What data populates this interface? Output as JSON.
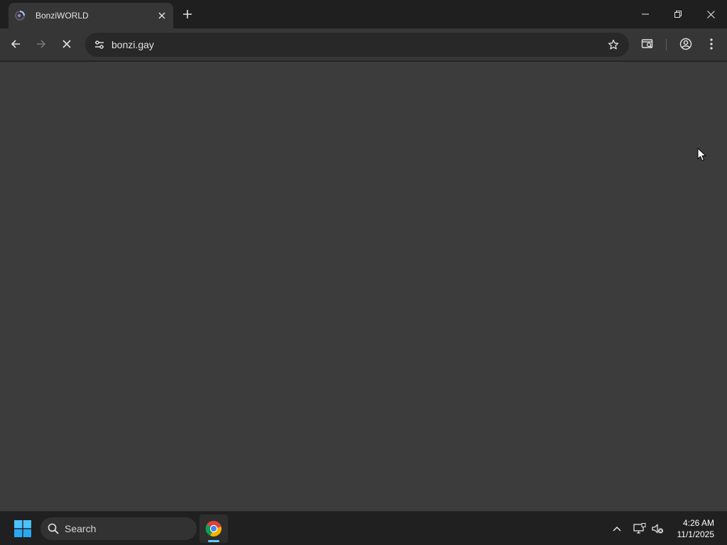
{
  "browser": {
    "tab": {
      "title": "BonziWORLD",
      "favicon": "loading-spinner-icon"
    },
    "address": {
      "url": "bonzi.gay"
    }
  },
  "taskbar": {
    "search_label": "Search",
    "clock": {
      "time": "4:26 AM",
      "date": "11/1/2025"
    }
  },
  "colors": {
    "titlebar": "#1f1f1f",
    "toolbar": "#363636",
    "omnibox": "#282828",
    "page_background": "#3c3c3c",
    "taskbar": "#202020",
    "accent": "#60cdff"
  }
}
